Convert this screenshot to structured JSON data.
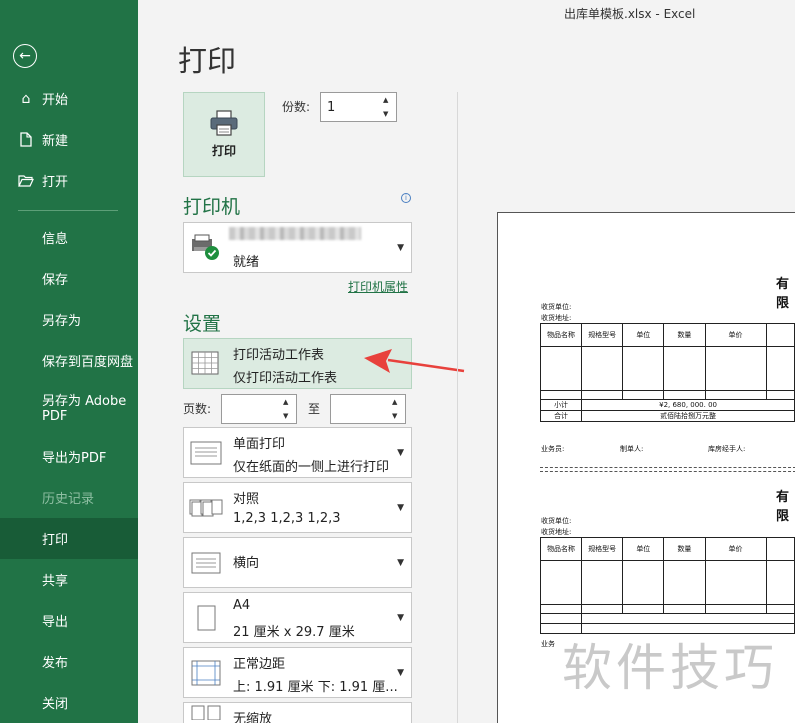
{
  "window": {
    "title": "出库单模板.xlsx  -  Excel"
  },
  "sidebar": {
    "items": [
      {
        "label": "开始",
        "icon": "home-icon"
      },
      {
        "label": "新建",
        "icon": "new-file-icon"
      },
      {
        "label": "打开",
        "icon": "folder-open-icon"
      },
      {
        "label": "信息"
      },
      {
        "label": "保存"
      },
      {
        "label": "另存为"
      },
      {
        "label": "保存到百度网盘"
      },
      {
        "label": "另存为 Adobe PDF"
      },
      {
        "label": "导出为PDF"
      },
      {
        "label": "历史记录",
        "disabled": true
      },
      {
        "label": "打印",
        "active": true
      },
      {
        "label": "共享"
      },
      {
        "label": "导出"
      },
      {
        "label": "发布"
      },
      {
        "label": "关闭"
      }
    ]
  },
  "print": {
    "page_title": "打印",
    "print_button": "打印",
    "copies_label": "份数:",
    "copies_value": "1",
    "printer_heading": "打印机",
    "printer_status": "就绪",
    "printer_properties": "打印机属性",
    "settings_heading": "设置",
    "scope": {
      "line1": "打印活动工作表",
      "line2": "仅打印活动工作表"
    },
    "pages_label": "页数:",
    "to_label": "至",
    "sides": {
      "line1": "单面打印",
      "line2": "仅在纸面的一侧上进行打印"
    },
    "collate": {
      "line1": "对照",
      "line2": "1,2,3     1,2,3     1,2,3"
    },
    "orientation": {
      "line1": "横向"
    },
    "paper": {
      "line1": "A4",
      "line2": "21 厘米 x 29.7 厘米"
    },
    "margins": {
      "line1": "正常边距",
      "line2": "上: 1.91 厘米 下: 1.91 厘..."
    },
    "scaling": {
      "line1": "无缩放"
    }
  },
  "preview": {
    "title1": "有限",
    "title2": "有限",
    "receiver_unit": "收货单位:",
    "receiver_addr": "收货地址:",
    "headers": [
      "物品名称",
      "规格型号",
      "单位",
      "数量",
      "单价"
    ],
    "subtotal_label": "小计",
    "subtotal_value": "¥2, 680, 000. 00",
    "total_label": "合计",
    "total_value": "贰佰陆拾捌万元整",
    "salesman": "业务员:",
    "maker": "制单人:",
    "warehouse": "库房经手人:",
    "footer_partial": "业务"
  },
  "watermark": "软件技巧",
  "colors": {
    "sidebar": "#217346",
    "active": "#185c37",
    "accent_bg": "#dcebe1",
    "arrow": "#e8413c"
  }
}
